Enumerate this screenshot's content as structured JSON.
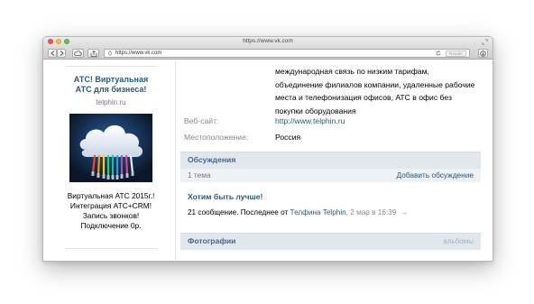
{
  "browser": {
    "title": "https://www.vk.com",
    "url": "https://www.vk.com",
    "reader_label": "Reader"
  },
  "ad": {
    "title": "АТС! Виртуальная АТС для бизнеса!",
    "domain": "telphin.ru",
    "text": "Виртуальная АТС 2015г.! Интеграция АТС+CRM! Запись звонков! Подключение 0р."
  },
  "group": {
    "description": "международная связь по низким тарифам, объединение филиалов компании, удаленные рабочие места и телефонизация офисов, АТС в офис без покупки оборудования",
    "website_label": "Веб-сайт:",
    "website_value": "http://www.telphin.ru",
    "location_label": "Местоположение:",
    "location_value": "Россия"
  },
  "discussions": {
    "header": "Обсуждения",
    "count": "1 тема",
    "add_label": "Добавить обсуждение",
    "topic": {
      "title": "Хотим быть лучше!",
      "meta_prefix": "21 сообщение. Последнее от",
      "author": "Телфина Telphin",
      "date": ", 2 мар в 16:39",
      "arrow": "→"
    }
  },
  "photos": {
    "header": "Фотографии",
    "albums_label": "альбомы"
  },
  "colors": {
    "link": "#2b587a",
    "section_header_bg": "#e1e7ed",
    "section_header_text": "#45688e"
  }
}
